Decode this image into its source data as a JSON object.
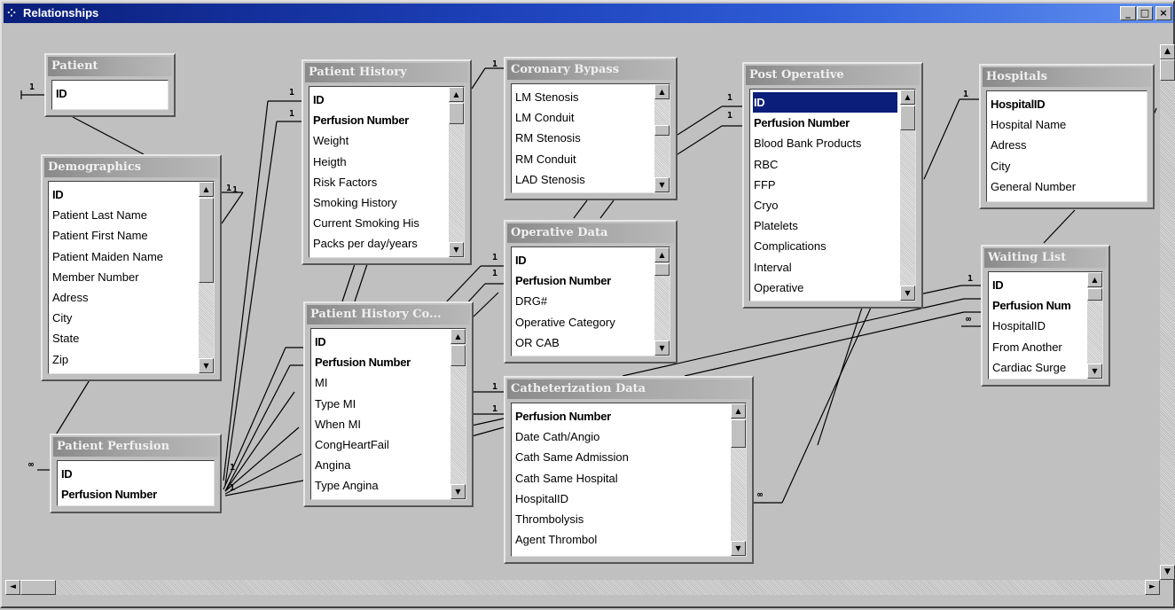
{
  "window": {
    "title": "Relationships",
    "app_icon": "relationship-icon",
    "controls": [
      "_",
      "□",
      "×"
    ]
  },
  "tables": [
    {
      "id": "patient",
      "name": "Patient",
      "fields": [
        "ID"
      ],
      "key_fields": [
        0
      ],
      "scroll": false
    },
    {
      "id": "demographics",
      "name": "Demographics",
      "fields": [
        "ID",
        "Patient Last Name",
        "Patient First Name",
        "Patient Maiden Name",
        "Member Number",
        "Adress",
        "City",
        "State",
        "Zip"
      ],
      "key_fields": [
        0
      ],
      "scroll": true
    },
    {
      "id": "patient-perfusion",
      "name": "Patient Perfusion",
      "fields": [
        "ID",
        "Perfusion Number"
      ],
      "key_fields": [
        0,
        1
      ],
      "scroll": false
    },
    {
      "id": "patient-history",
      "name": "Patient History",
      "fields": [
        "ID",
        "Perfusion Number",
        "Weight",
        "Heigth",
        "Risk Factors",
        "Smoking History",
        "Current Smoking His",
        "Packs per day/years"
      ],
      "key_fields": [
        0,
        1
      ],
      "scroll": true
    },
    {
      "id": "patient-history-co",
      "name": "Patient History Co...",
      "fields": [
        "ID",
        "Perfusion Number",
        "MI",
        "Type MI",
        "When MI",
        "CongHeartFail",
        "Angina",
        "Type Angina"
      ],
      "key_fields": [
        0,
        1
      ],
      "scroll": true
    },
    {
      "id": "coronary-bypass",
      "name": "Coronary Bypass",
      "fields": [
        "LM Stenosis",
        "LM Conduit",
        "RM Stenosis",
        "RM Conduit",
        "LAD Stenosis"
      ],
      "key_fields": [],
      "scroll": true
    },
    {
      "id": "operative-data",
      "name": "Operative Data",
      "fields": [
        "ID",
        "Perfusion Number",
        "DRG#",
        "Operative Category",
        "OR CAB"
      ],
      "key_fields": [
        0,
        1
      ],
      "scroll": true
    },
    {
      "id": "catheterization-data",
      "name": "Catheterization Data",
      "fields": [
        "Perfusion Number",
        "Date Cath/Angio",
        "Cath Same Admission",
        "Cath Same Hospital",
        "HospitalID",
        "Thrombolysis",
        "Agent Thrombol"
      ],
      "key_fields": [
        0
      ],
      "scroll": true
    },
    {
      "id": "post-operative",
      "name": "Post Operative",
      "fields": [
        "ID",
        "Perfusion Number",
        "Blood Bank Products",
        "RBC",
        "FFP",
        "Cryo",
        "Platelets",
        "Complications",
        "Interval",
        "Operative"
      ],
      "key_fields": [
        0,
        1
      ],
      "selected": 0,
      "scroll": true
    },
    {
      "id": "hospitals",
      "name": "Hospitals",
      "fields": [
        "HospitalID",
        "Hospital Name",
        "Adress",
        "City",
        "General Number"
      ],
      "key_fields": [
        0
      ],
      "scroll": false
    },
    {
      "id": "waiting-list",
      "name": "Waiting List",
      "fields": [
        "ID",
        "Perfusion Num",
        "HospitalID",
        "From Another",
        "Cardiac Surge"
      ],
      "key_fields": [
        0,
        1
      ],
      "scroll": true
    }
  ],
  "markers": [
    "1",
    "1",
    "1",
    "1",
    "1",
    "1",
    "1",
    "1",
    "1",
    "1",
    "1",
    "1",
    "1",
    "1",
    "1",
    "1",
    "∞",
    "∞",
    "∞"
  ],
  "colors": {
    "titlebar_start": "#0a1e7a",
    "titlebar_end": "#5f8ff0",
    "table_header": "#9a9a9a",
    "selection": "#0a1e7a",
    "line": "#000000"
  }
}
